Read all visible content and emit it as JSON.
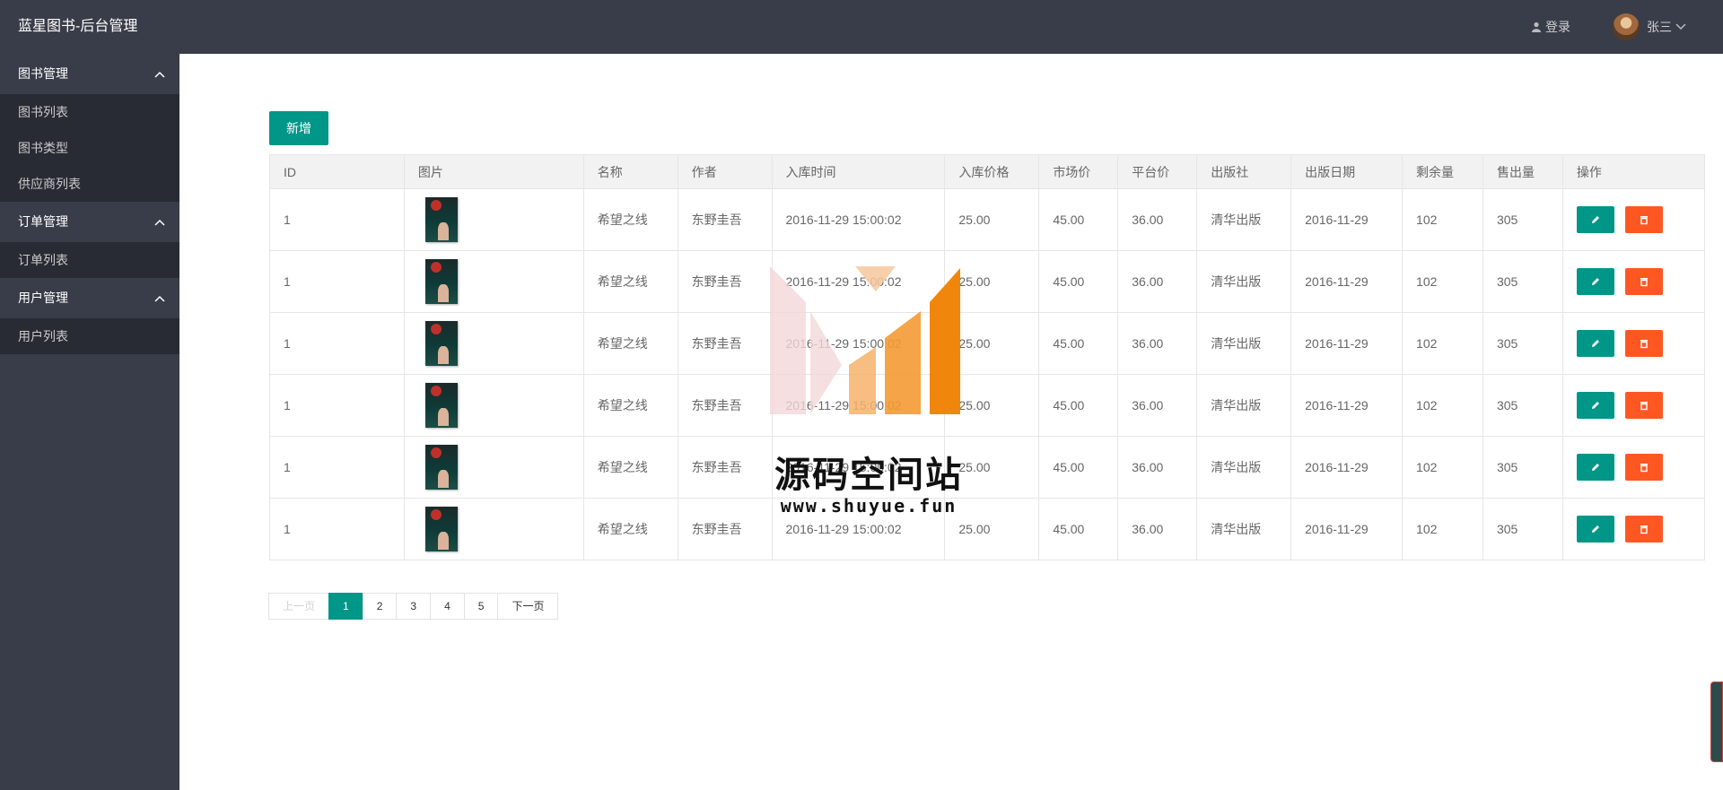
{
  "header": {
    "title": "蓝星图书-后台管理",
    "login_label": "登录",
    "username": "张三"
  },
  "sidebar": {
    "groups": [
      {
        "title": "图书管理",
        "items": [
          {
            "label": "图书列表"
          },
          {
            "label": "图书类型"
          },
          {
            "label": "供应商列表"
          }
        ]
      },
      {
        "title": "订单管理",
        "items": [
          {
            "label": "订单列表"
          }
        ]
      },
      {
        "title": "用户管理",
        "items": [
          {
            "label": "用户列表"
          }
        ]
      }
    ]
  },
  "toolbar": {
    "add_label": "新增"
  },
  "table": {
    "columns": [
      "ID",
      "图片",
      "名称",
      "作者",
      "入库时间",
      "入库价格",
      "市场价",
      "平台价",
      "出版社",
      "出版日期",
      "剩余量",
      "售出量",
      "操作"
    ],
    "rows": [
      {
        "id": "1",
        "name": "希望之线",
        "author": "东野圭吾",
        "in_time": "2016-11-29 15:00:02",
        "in_price": "25.00",
        "market_price": "45.00",
        "platform_price": "36.00",
        "publisher": "清华出版",
        "pub_date": "2016-11-29",
        "remaining": "102",
        "sold": "305"
      },
      {
        "id": "1",
        "name": "希望之线",
        "author": "东野圭吾",
        "in_time": "2016-11-29 15:00:02",
        "in_price": "25.00",
        "market_price": "45.00",
        "platform_price": "36.00",
        "publisher": "清华出版",
        "pub_date": "2016-11-29",
        "remaining": "102",
        "sold": "305"
      },
      {
        "id": "1",
        "name": "希望之线",
        "author": "东野圭吾",
        "in_time": "2016-11-29 15:00:02",
        "in_price": "25.00",
        "market_price": "45.00",
        "platform_price": "36.00",
        "publisher": "清华出版",
        "pub_date": "2016-11-29",
        "remaining": "102",
        "sold": "305"
      },
      {
        "id": "1",
        "name": "希望之线",
        "author": "东野圭吾",
        "in_time": "2016-11-29 15:00:02",
        "in_price": "25.00",
        "market_price": "45.00",
        "platform_price": "36.00",
        "publisher": "清华出版",
        "pub_date": "2016-11-29",
        "remaining": "102",
        "sold": "305"
      },
      {
        "id": "1",
        "name": "希望之线",
        "author": "东野圭吾",
        "in_time": "2016-11-29 15:00:02",
        "in_price": "25.00",
        "market_price": "45.00",
        "platform_price": "36.00",
        "publisher": "清华出版",
        "pub_date": "2016-11-29",
        "remaining": "102",
        "sold": "305"
      },
      {
        "id": "1",
        "name": "希望之线",
        "author": "东野圭吾",
        "in_time": "2016-11-29 15:00:02",
        "in_price": "25.00",
        "market_price": "45.00",
        "platform_price": "36.00",
        "publisher": "清华出版",
        "pub_date": "2016-11-29",
        "remaining": "102",
        "sold": "305"
      }
    ]
  },
  "pagination": {
    "prev": "上一页",
    "pages": [
      "1",
      "2",
      "3",
      "4",
      "5"
    ],
    "current": "1",
    "next": "下一页"
  },
  "watermark": {
    "title": "源码空间站",
    "url": "www.shuyue.fun"
  },
  "colors": {
    "header_bg": "#393d49",
    "submenu_bg": "#282b33",
    "primary": "#009688",
    "danger": "#ff5722"
  }
}
